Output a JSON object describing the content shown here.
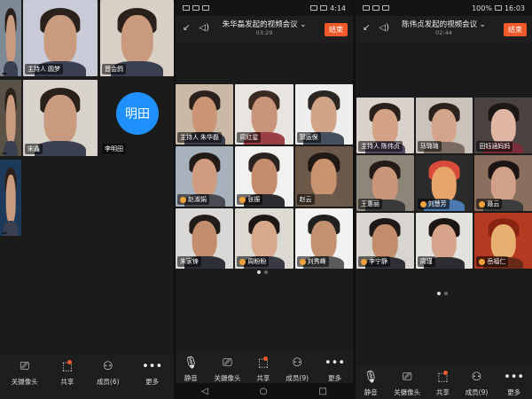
{
  "panel1": {
    "tiles": [
      {
        "name": "",
        "host": "",
        "bg": "#7d8a96"
      },
      {
        "name": "圆梦",
        "host": "主持人",
        "bg": "#c9ccd8"
      },
      {
        "name": "晋会鸽",
        "host": "",
        "bg": "#d9cfc4"
      },
      {
        "name": "",
        "host": "",
        "bg": "#5a5147"
      },
      {
        "name": "宋鑫",
        "host": "",
        "bg": "#d8d4cc"
      },
      {
        "name": "李明田",
        "host": "",
        "bg": "#1b1b1b",
        "avatar": "明田",
        "avatar_color": "#1e90ff"
      },
      {
        "name": "",
        "host": "",
        "bg": "#1e3a5a"
      }
    ],
    "toolbar": [
      {
        "label": "关摄像头",
        "icon": "camera-icon",
        "glyph": "⎚"
      },
      {
        "label": "共享",
        "icon": "share-screen-icon",
        "glyph": "⬚",
        "badge": true
      },
      {
        "label": "成员(6)",
        "icon": "members-icon",
        "glyph": "⚇"
      },
      {
        "label": "更多",
        "icon": "more-icon",
        "glyph": "•••"
      }
    ]
  },
  "panel2": {
    "status_time": "4:14",
    "title": "朱华磊发起的视频会议",
    "duration": "03:29",
    "end_label": "结束",
    "tiles": [
      {
        "name": "朱华磊",
        "host": "主持人",
        "mic": false,
        "bg": "#cbb9a8",
        "skin": "#c99575",
        "hair": "#2a211c",
        "shirt": "#3b3f4b"
      },
      {
        "name": "周红星",
        "host": "",
        "mic": false,
        "bg": "#e8e4df",
        "skin": "#c9957a",
        "hair": "#3a2a22",
        "shirt": "#9a3f44"
      },
      {
        "name": "郭运保",
        "host": "",
        "mic": false,
        "bg": "#eeeeee",
        "skin": "#d2a487",
        "hair": "#2c2623",
        "shirt": "#44505e"
      },
      {
        "name": "赵淑娟",
        "host": "",
        "mic": true,
        "bg": "#a7b2bc",
        "skin": "#cf9c80",
        "hair": "#231b17",
        "shirt": "#4a4a52"
      },
      {
        "name": "张振",
        "host": "",
        "mic": true,
        "bg": "#f1f1ef",
        "skin": "#c58c6b",
        "hair": "#2b2320",
        "shirt": "#2b2b30"
      },
      {
        "name": "赵云",
        "host": "",
        "mic": false,
        "bg": "#6b5848",
        "skin": "#c8946f",
        "hair": "#1f1814",
        "shirt": "#6e5a4a"
      },
      {
        "name": "朱家锋",
        "host": "",
        "mic": false,
        "bg": "#d9d8d6",
        "skin": "#c28e6e",
        "hair": "#221c19",
        "shirt": "#2e3038"
      },
      {
        "name": "周盼盼",
        "host": "",
        "mic": true,
        "bg": "#dcd8d2",
        "skin": "#d7a88c",
        "hair": "#1d1613",
        "shirt": "#3a3a44"
      },
      {
        "name": "刘秀峰",
        "host": "",
        "mic": true,
        "bg": "#f2f2f2",
        "skin": "#c49170",
        "hair": "#20201f",
        "shirt": "#5a5a5a"
      }
    ],
    "toolbar": [
      {
        "label": "静音",
        "icon": "microphone-icon",
        "glyph": "🎙"
      },
      {
        "label": "关摄像头",
        "icon": "camera-icon",
        "glyph": "⎚"
      },
      {
        "label": "共享",
        "icon": "share-screen-icon",
        "glyph": "⬚",
        "badge": true
      },
      {
        "label": "成员(9)",
        "icon": "members-icon",
        "glyph": "⚇"
      },
      {
        "label": "更多",
        "icon": "more-icon",
        "glyph": "•••"
      }
    ],
    "nav": [
      {
        "icon": "back-nav-icon",
        "glyph": "◁"
      },
      {
        "icon": "home-nav-icon",
        "glyph": "○"
      },
      {
        "icon": "recents-nav-icon",
        "glyph": "□"
      }
    ]
  },
  "panel3": {
    "status_battery": "100%",
    "status_time": "16:03",
    "title": "陈伟贞发起的视频会议",
    "duration": "02:44",
    "end_label": "结束",
    "tiles": [
      {
        "name": "陈伟贞",
        "host": "主持人",
        "mic": false,
        "bg": "#d9d3cc",
        "skin": "#d3a287",
        "hair": "#2a1f1a",
        "shirt": "#5a4a66"
      },
      {
        "name": "马璐璐",
        "host": "",
        "mic": false,
        "bg": "#c9c3bb",
        "skin": "#d4a58a",
        "hair": "#2c211c",
        "shirt": "#7a6a60"
      },
      {
        "name": "田钰涵妈妈",
        "host": "",
        "mic": false,
        "bg": "#4a4340",
        "skin": "#e0b7a2",
        "hair": "#1d1715",
        "shirt": "#7a2f3a"
      },
      {
        "name": "王惠丽",
        "host": "",
        "mic": false,
        "bg": "#8c8578",
        "skin": "#c9967a",
        "hair": "#241c18",
        "shirt": "#3a3a3a"
      },
      {
        "name": "刘慧芳",
        "host": "",
        "mic": true,
        "bg": "#2b2b2b",
        "skin": "#e8a56a",
        "hair": "#d84a3a",
        "shirt": "#4a7ab0"
      },
      {
        "name": "聂云",
        "host": "",
        "mic": true,
        "bg": "#8a6e5e",
        "skin": "#d0a088",
        "hair": "#1a1412",
        "shirt": "#3c3c3c"
      },
      {
        "name": "李宁静",
        "host": "",
        "mic": true,
        "bg": "#d8d4cf",
        "skin": "#c28d6b",
        "hair": "#1f1a18",
        "shirt": "#2e3036"
      },
      {
        "name": "周瑾",
        "host": "",
        "mic": false,
        "bg": "#e4e2df",
        "skin": "#d4a38a",
        "hair": "#1c1614",
        "shirt": "#2e2e32"
      },
      {
        "name": "岳福仁",
        "host": "",
        "mic": true,
        "bg": "#b53a22",
        "skin": "#e8b070",
        "hair": "#8a2412",
        "shirt": "#6a2a18"
      }
    ],
    "toolbar": [
      {
        "label": "静音",
        "icon": "microphone-icon",
        "glyph": "🎙"
      },
      {
        "label": "关摄像头",
        "icon": "camera-icon",
        "glyph": "⎚"
      },
      {
        "label": "共享",
        "icon": "share-screen-icon",
        "glyph": "⬚",
        "badge": true
      },
      {
        "label": "成员(9)",
        "icon": "members-icon",
        "glyph": "⚇"
      },
      {
        "label": "更多",
        "icon": "more-icon",
        "glyph": "•••"
      }
    ]
  },
  "colors": {
    "end_button": "#f25a2c",
    "avatar_blue": "#1e90ff",
    "mic_active": "#f2a23a"
  }
}
